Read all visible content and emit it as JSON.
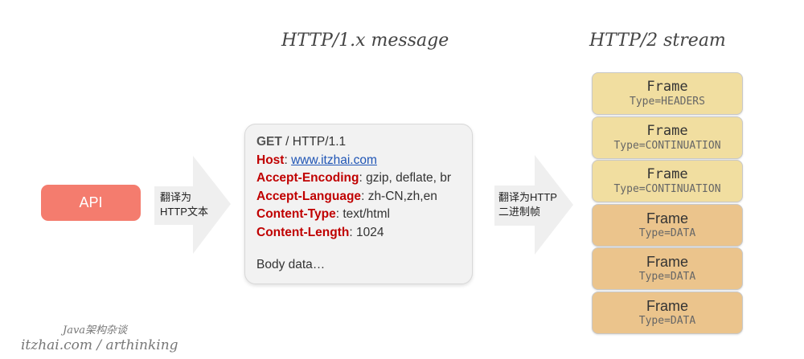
{
  "titles": {
    "http1": "HTTP/1.x message",
    "http2": "HTTP/2 stream"
  },
  "api": {
    "label": "API"
  },
  "arrows": [
    {
      "line1": "翻译为",
      "line2": "HTTP文本"
    },
    {
      "line1": "翻译为HTTP",
      "line2": "二进制帧"
    }
  ],
  "message": {
    "request_line": {
      "method": "GET",
      "rest": " / HTTP/1.1"
    },
    "headers": [
      {
        "key": "Host",
        "sep": ": ",
        "value": "www.itzhai.com",
        "link": true
      },
      {
        "key": "Accept-Encoding",
        "sep": ": ",
        "value": "gzip, deflate, br",
        "link": false
      },
      {
        "key": "Accept-Language",
        "sep": ": ",
        "value": "zh-CN,zh,en",
        "link": false
      },
      {
        "key": "Content-Type",
        "sep": ": ",
        "value": "text/html",
        "link": false
      },
      {
        "key": "Content-Length",
        "sep": ": ",
        "value": "1024",
        "link": false
      }
    ],
    "body": "Body data…"
  },
  "frames": [
    {
      "name": "Frame",
      "type": "Type=HEADERS",
      "color": "#f1dea0",
      "mono": true
    },
    {
      "name": "Frame",
      "type": "Type=CONTINUATION",
      "color": "#f1dea0",
      "mono": true
    },
    {
      "name": "Frame",
      "type": "Type=CONTINUATION",
      "color": "#f1dea0",
      "mono": true
    },
    {
      "name": "Frame",
      "type": "Type=DATA",
      "color": "#ebc48c",
      "mono": false
    },
    {
      "name": "Frame",
      "type": "Type=DATA",
      "color": "#ebc48c",
      "mono": false
    },
    {
      "name": "Frame",
      "type": "Type=DATA",
      "color": "#ebc48c",
      "mono": false
    }
  ],
  "footer": {
    "brand": "Java架构杂谈",
    "site": "itzhai.com / arthinking"
  }
}
